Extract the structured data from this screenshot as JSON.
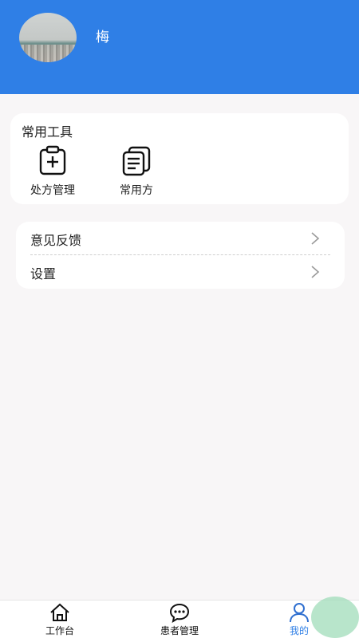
{
  "profile": {
    "name": "梅"
  },
  "tools": {
    "title": "常用工具",
    "items": [
      {
        "label": "处方管理",
        "icon": "prescription-icon"
      },
      {
        "label": "常用方",
        "icon": "common-prescription-icon"
      }
    ]
  },
  "menu": {
    "items": [
      {
        "label": "意见反馈",
        "icon": "chevron-right-icon"
      },
      {
        "label": "设置",
        "icon": "chevron-right-icon"
      }
    ]
  },
  "tabbar": {
    "items": [
      {
        "label": "工作台",
        "icon": "home-icon"
      },
      {
        "label": "患者管理",
        "icon": "chat-icon"
      },
      {
        "label": "我的",
        "icon": "user-icon",
        "active": true
      }
    ]
  },
  "colors": {
    "header": "#2f7fe6",
    "active_tab": "#2f7fe6",
    "background": "#f8f6f7"
  }
}
